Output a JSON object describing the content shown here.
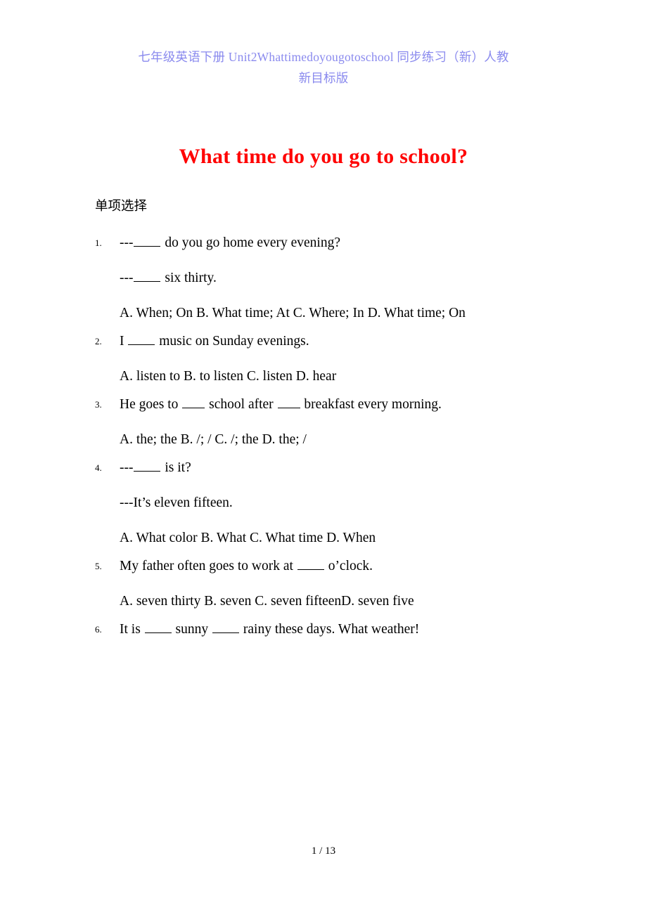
{
  "header": {
    "line1": "七年级英语下册 Unit2Whattimedoyougotoschool 同步练习（新）人教",
    "line2": "新目标版",
    "color": "#8a8aee"
  },
  "title": {
    "text": "What time do you go to school?",
    "color": "#ff0000"
  },
  "section": {
    "heading": "单项选择"
  },
  "questions": [
    {
      "number": "1.",
      "lines": [
        "---____ do you go home every evening?",
        "---____ six thirty.",
        "A. When; On        B. What time; At  C. Where; In          D. What time; On"
      ],
      "prompt_a": "---",
      "prompt_a_tail": " do you go home every evening?",
      "prompt_b": "---",
      "prompt_b_tail": " six thirty.",
      "options": "A. When; On        B. What time; At  C. Where; In          D. What time; On"
    },
    {
      "number": "2.",
      "stem_pre": "I ",
      "stem_post": " music on Sunday evenings.",
      "options": "A. listen to      B. to listen     C. listen          D. hear"
    },
    {
      "number": "3.",
      "stem_pre": "He goes to ",
      "stem_mid": " school after ",
      "stem_post": " breakfast every morning.",
      "options": "A. the; the      B. /; /             C. /; the         D. the; /"
    },
    {
      "number": "4.",
      "prompt_a": "---",
      "prompt_a_tail": " is it?",
      "prompt_b": "---It’s eleven fifteen.",
      "options": "A. What color       B. What          C. What time       D. When"
    },
    {
      "number": "5.",
      "stem_pre": "My father often goes to work at ",
      "stem_post": " o’clock.",
      "options": "A. seven thirty      B. seven           C. seven fifteenD. seven five"
    },
    {
      "number": "6.",
      "stem_pre": "It is ",
      "stem_mid": " sunny ",
      "stem_post": " rainy these days. What weather!"
    }
  ],
  "footer": {
    "page_label": "1 / 13"
  }
}
